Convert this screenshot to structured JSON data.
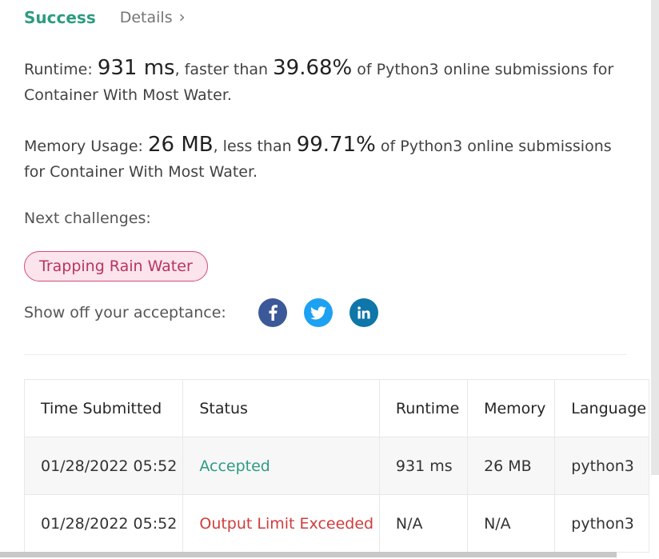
{
  "header": {
    "status": "Success",
    "details_label": "Details",
    "chevron": "›"
  },
  "runtime": {
    "label": "Runtime:",
    "value": "931 ms",
    "comparator": ", faster than",
    "percent": "39.68%",
    "suffix": " of Python3 online submissions for Container With Most Water."
  },
  "memory": {
    "label": "Memory Usage:",
    "value": "26 MB",
    "comparator": ", less than",
    "percent": "99.71%",
    "suffix": " of Python3 online submissions for Container With Most Water."
  },
  "next": {
    "label": "Next challenges:",
    "challenges": [
      "Trapping Rain Water"
    ]
  },
  "share": {
    "label": "Show off your acceptance:",
    "icons": [
      "facebook-icon",
      "twitter-icon",
      "linkedin-icon"
    ]
  },
  "table": {
    "headers": [
      "Time Submitted",
      "Status",
      "Runtime",
      "Memory",
      "Language"
    ],
    "rows": [
      {
        "time": "01/28/2022 05:52",
        "status": "Accepted",
        "runtime": "931 ms",
        "memory": "26 MB",
        "language": "python3"
      },
      {
        "time": "01/28/2022 05:52",
        "status": "Output Limit Exceeded",
        "runtime": "N/A",
        "memory": "N/A",
        "language": "python3"
      }
    ]
  },
  "colors": {
    "success": "#2d9b83",
    "error": "#d03c3c",
    "pill_border": "#d24e78",
    "pill_bg": "#fbe4ec",
    "facebook": "#3b5998",
    "twitter": "#1da1f2",
    "linkedin": "#0e76a8"
  }
}
